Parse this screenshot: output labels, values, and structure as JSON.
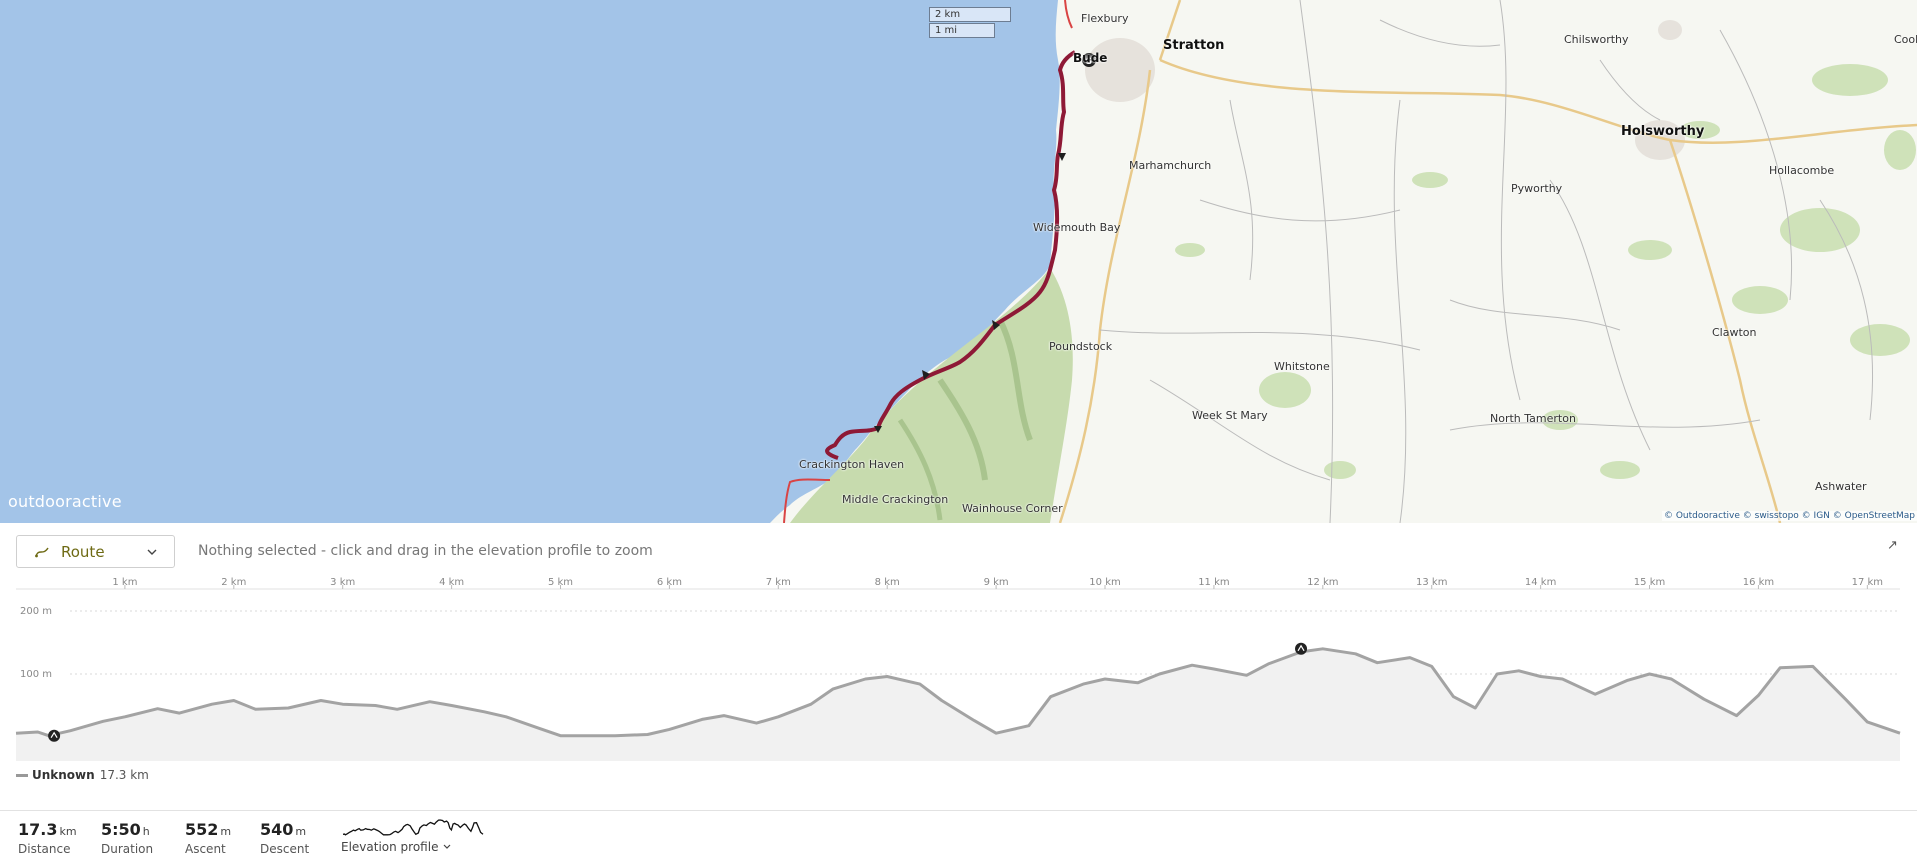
{
  "map": {
    "scale_km": "2 km",
    "scale_mi": "1 mi",
    "logo": "outdooractive",
    "attribution": "© Outdooractive © swisstopo © IGN © OpenStreetMap",
    "places": {
      "flexbury": "Flexbury",
      "bude": "Bude",
      "stratton": "Stratton",
      "chilsworthy": "Chilsworthy",
      "cook": "Cook",
      "holsworthy": "Holsworthy",
      "marhamchurch": "Marhamchurch",
      "pyworthy": "Pyworthy",
      "hollacombe": "Hollacombe",
      "widemouth_bay": "Widemouth Bay",
      "poundstock": "Poundstock",
      "clawton": "Clawton",
      "whitstone": "Whitstone",
      "week_st_mary": "Week St Mary",
      "north_tamerton": "North Tamerton",
      "crackington_haven": "Crackington Haven",
      "middle_crackington": "Middle Crackington",
      "wainhouse_corner": "Wainhouse Corner",
      "ashwater": "Ashwater"
    },
    "colors": {
      "sea": "#a3c4e8",
      "route": "#9b1b38",
      "green": "#c9dcb0"
    }
  },
  "panel": {
    "route_select": "Route",
    "hint": "Nothing selected - click and drag in the elevation profile to zoom",
    "expand_icon": "collapse-arrows-icon"
  },
  "chart_data": {
    "type": "area",
    "xlabel": "",
    "ylabel": "",
    "x_ticks": [
      "1 km",
      "2 km",
      "3 km",
      "4 km",
      "5 km",
      "6 km",
      "7 km",
      "8 km",
      "9 km",
      "10 km",
      "11 km",
      "12 km",
      "13 km",
      "14 km",
      "15 km",
      "16 km",
      "17 km"
    ],
    "y_ticks": [
      "200 m",
      "100 m"
    ],
    "xlim": [
      0,
      17.3
    ],
    "ylim": [
      0,
      200
    ],
    "series": [
      {
        "name": "Unknown",
        "x": [
          0,
          0.2,
          0.3,
          0.5,
          0.8,
          1.0,
          1.3,
          1.5,
          1.8,
          2.0,
          2.2,
          2.5,
          2.8,
          3.0,
          3.3,
          3.5,
          3.8,
          4.0,
          4.3,
          4.5,
          4.8,
          5.0,
          5.3,
          5.5,
          5.8,
          6.0,
          6.3,
          6.5,
          6.8,
          7.0,
          7.3,
          7.5,
          7.8,
          8.0,
          8.3,
          8.5,
          8.8,
          9.0,
          9.3,
          9.5,
          9.8,
          10.0,
          10.3,
          10.5,
          10.8,
          11.0,
          11.3,
          11.5,
          11.8,
          12.0,
          12.3,
          12.5,
          12.8,
          13.0,
          13.2,
          13.4,
          13.6,
          13.8,
          14.0,
          14.2,
          14.5,
          14.8,
          15.0,
          15.2,
          15.5,
          15.8,
          16.0,
          16.2,
          16.5,
          16.8,
          17.0,
          17.3
        ],
        "y": [
          6,
          8,
          2,
          10,
          25,
          32,
          45,
          38,
          52,
          58,
          44,
          46,
          58,
          52,
          50,
          44,
          56,
          50,
          40,
          32,
          14,
          2,
          2,
          2,
          4,
          12,
          28,
          34,
          22,
          32,
          52,
          76,
          92,
          96,
          84,
          58,
          26,
          6,
          18,
          64,
          84,
          92,
          86,
          100,
          114,
          108,
          98,
          116,
          135,
          140,
          132,
          118,
          126,
          112,
          64,
          46,
          100,
          105,
          96,
          92,
          68,
          90,
          100,
          92,
          60,
          34,
          66,
          110,
          112,
          60,
          24,
          6
        ],
        "unit_x": "km",
        "unit_y": "m"
      }
    ],
    "markers": [
      {
        "label": "start",
        "x": 0.35,
        "y": 2
      },
      {
        "label": "highest point",
        "x": 11.8,
        "y": 140
      }
    ],
    "total": "17.3 km"
  },
  "stats": {
    "distance": {
      "value": "17.3",
      "unit": "km",
      "label": "Distance"
    },
    "duration": {
      "value": "5:50",
      "unit": "h",
      "label": "Duration"
    },
    "ascent": {
      "value": "552",
      "unit": "m",
      "label": "Ascent"
    },
    "descent": {
      "value": "540",
      "unit": "m",
      "label": "Descent"
    },
    "elevation_profile": "Elevation profile"
  }
}
